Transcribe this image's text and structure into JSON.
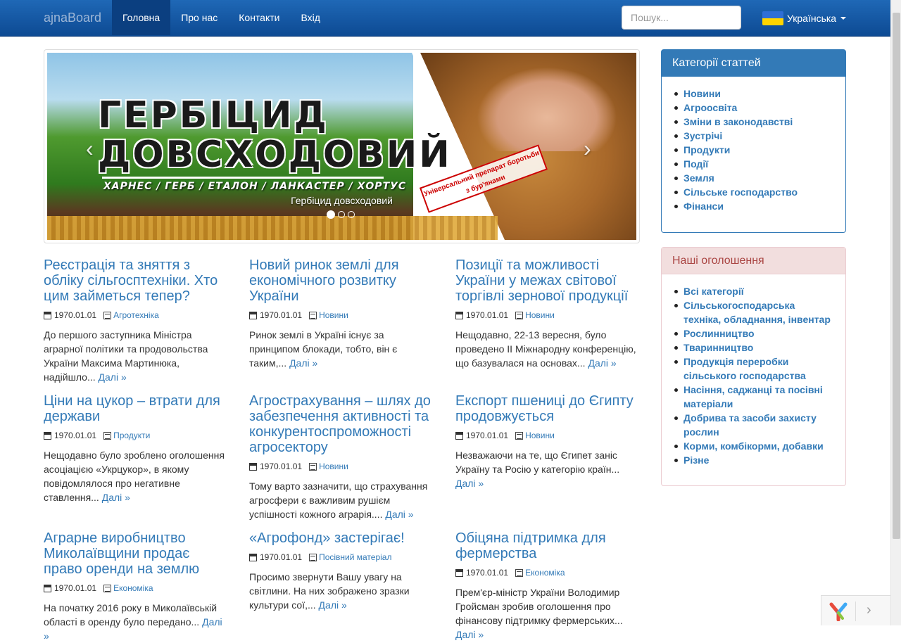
{
  "navbar": {
    "brand": "ajnaBoard",
    "items": [
      "Головна",
      "Про нас",
      "Контакти",
      "Вхід"
    ],
    "active": "Головна",
    "search_placeholder": "Пошук...",
    "language": "Українська"
  },
  "carousel": {
    "ad_title_line1": "ГЕРБІЦИД",
    "ad_title_line2": "ДОВСХОДОВИЙ",
    "ad_brands": "ХАРНЕС / ГЕРБ / ЕТАЛОН / ЛАНКАСТЕР / ХОРТУС",
    "ad_stamp": "Універсальний препарат боротьби з бур'янами",
    "caption": "Гербіцид довсходовий",
    "prev": "‹",
    "next": "›",
    "slides_count": 3,
    "active_slide": 1
  },
  "articles": [
    {
      "title": "Реєстрація та зняття з обліку сільгосптехніки. Хто цим займеться тепер?",
      "date": "1970.01.01",
      "category": "Агротехніка",
      "excerpt": "До першого заступника Міністра аграрної політики та продовольства України Максима Мартинюка, надійшло...",
      "more": "Далі »"
    },
    {
      "title": "Новий ринок землі для економічного розвитку України",
      "date": "1970.01.01",
      "category": "Новини",
      "excerpt": "Ринок землі в Україні існує за принципом блокади, тобто, він є таким,...",
      "more": "Далі »"
    },
    {
      "title": "Позиції та можливості України у межах світової торгівлі зернової продукції",
      "date": "1970.01.01",
      "category": "Новини",
      "excerpt": "Нещодавно, 22-13 вересня, було проведено ІІ Міжнародну конференцію, що базувалася на основах...",
      "more": "Далі »"
    },
    {
      "title": "Ціни на цукор – втрати для держави",
      "date": "1970.01.01",
      "category": "Продукти",
      "excerpt": "Нещодавно було зроблено оголошення асоціацією «Укрцукор», в якому повідомлялося про негативне ставлення...",
      "more": "Далі »"
    },
    {
      "title": "Агрострахування – шлях до забезпечення активності та конкурентоспроможності агросектору",
      "date": "1970.01.01",
      "category": "Новини",
      "excerpt": "Тому варто зазначити, що страхування агросфери є важливим рушієм успішності кожного аграрія....",
      "more": "Далі »"
    },
    {
      "title": "Експорт пшениці до Єгипту продовжується",
      "date": "1970.01.01",
      "category": "Новини",
      "excerpt": "Незважаючи на те, що Єгипет заніс Україну та Росію у категорію країн...",
      "more": "Далі »"
    },
    {
      "title": "Аграрне виробництво Миколаївщини продає право оренди на землю",
      "date": "1970.01.01",
      "category": "Економіка",
      "excerpt": "На початку 2016 року в Миколаївській області в оренду було передано...",
      "more": "Далі »"
    },
    {
      "title": "«Агрофонд» застерігає!",
      "date": "1970.01.01",
      "category": "Посівний матеріал",
      "excerpt": "Просимо звернути Вашу увагу на світлини. На них зображено зразки культури сої,...",
      "more": "Далі »"
    },
    {
      "title": "Обіцяна підтримка для фермерства",
      "date": "1970.01.01",
      "category": "Економіка",
      "excerpt": "Прем'єр-міністр України Володимир Гройсман зробив оголошення про фінансову підтримку фермерських...",
      "more": "Далі »"
    }
  ],
  "sidebar": {
    "categories_title": "Категорії статтей",
    "categories": [
      "Новини",
      "Агроосвіта",
      "Зміни в законодавстві",
      "Зустрічі",
      "Продукти",
      "Події",
      "Земля",
      "Сільське господарство",
      "Фінанси"
    ],
    "ads_title": "Наші оголошення",
    "ads": [
      "Всі категорії",
      "Сільськогосподарська техніка, обладнання, інвентар",
      "Рослинництво",
      "Тваринництво",
      "Продукція переробки сільського господарства",
      "Насіння, саджанці та посівні матеріали",
      "Добрива та засоби захисту рослин",
      "Корми, комбікорми, добавки",
      "Різне"
    ]
  },
  "debug_toolbar": {
    "arrow": "›"
  }
}
